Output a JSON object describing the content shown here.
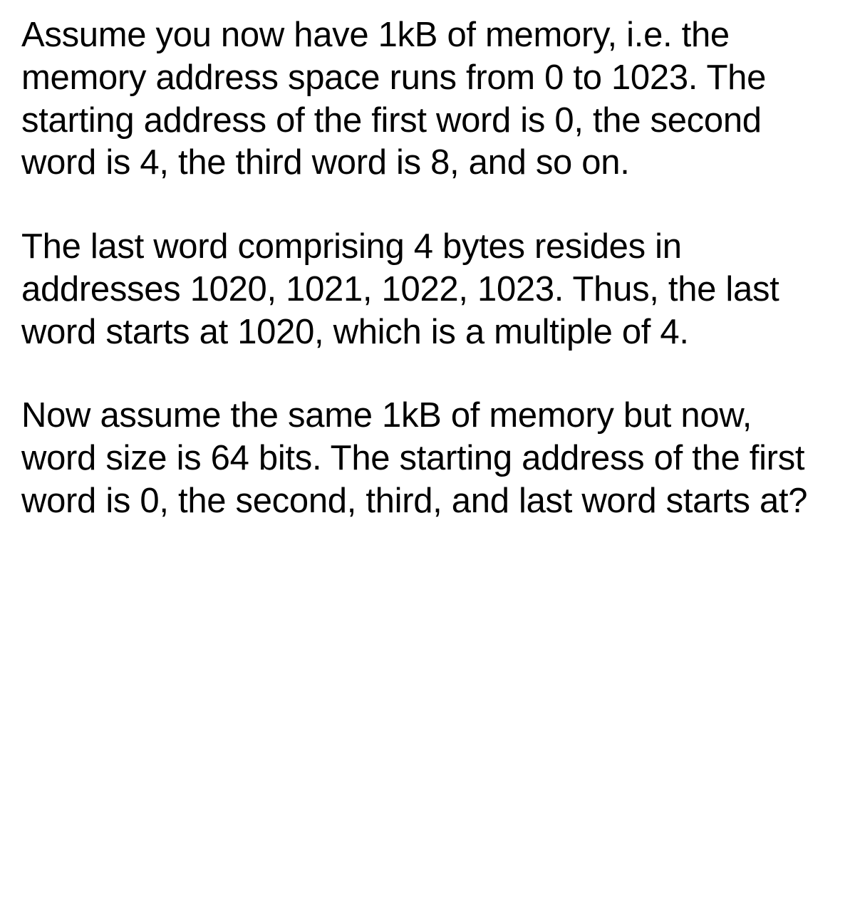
{
  "paragraphs": {
    "p1": "Assume you now have 1kB of memory, i.e. the memory address space runs from 0 to 1023. The starting address of the first word is 0, the second word is 4, the third word is 8, and so on.",
    "p2": "The last word comprising 4 bytes resides in addresses 1020, 1021, 1022, 1023. Thus, the last word starts at 1020, which is a multiple of 4.",
    "p3": "Now assume the same 1kB of memory but now, word size is 64 bits. The starting address of the first word is 0, the second, third, and last word starts at?"
  }
}
